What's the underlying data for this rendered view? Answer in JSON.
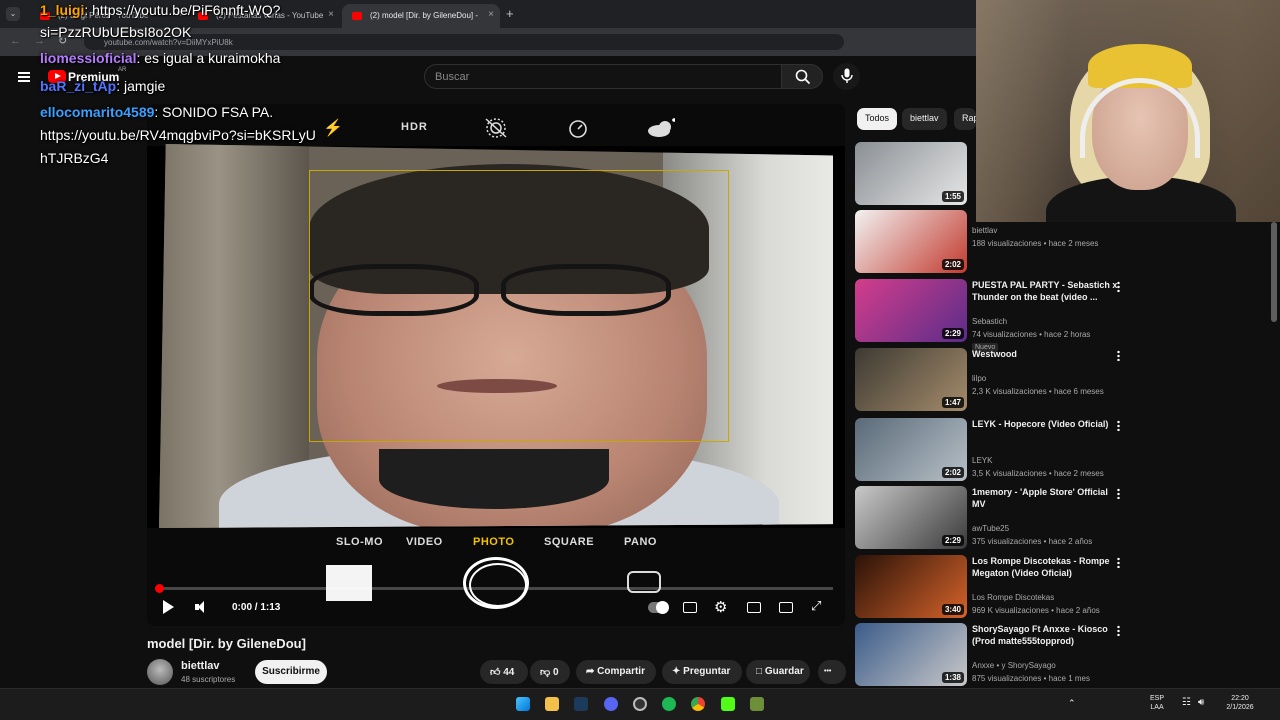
{
  "browser": {
    "tabs": [
      {
        "label": "(2) Luigi Pérez - YouTube",
        "active": false
      },
      {
        "label": "(2) Pestañas varias - YouTube",
        "active": false
      },
      {
        "label": "(2) model [Dir. by GileneDou] -",
        "active": true
      }
    ],
    "new_tab": "+",
    "url": "youtube.com/watch?v=DiiMYxPiU8k"
  },
  "youtube": {
    "logo_text": "Premium",
    "logo_region": "AR",
    "search_placeholder": "Buscar"
  },
  "camera_ui": {
    "top_labels": [
      "HDR"
    ],
    "modes": [
      "SLO-MO",
      "VIDEO",
      "PHOTO",
      "SQUARE",
      "PANO"
    ],
    "selected_mode": "PHOTO"
  },
  "player": {
    "time": "0:00 / 1:13",
    "progress_fraction": 0.0
  },
  "video": {
    "title": "model [Dir. by GileneDou]",
    "channel": "biettlav",
    "subscribers": "48 suscriptores",
    "subscribe_label": "Suscribirme",
    "likes": "44",
    "dislikes": "0",
    "share_label": "Compartir",
    "ask_label": "Preguntar",
    "save_label": "Guardar",
    "more_label": "•••"
  },
  "chips": [
    "Todos",
    "biettlav",
    "Rap"
  ],
  "recommendations": [
    {
      "title": "",
      "channel": "",
      "views": "",
      "duration": "1:55",
      "colors": [
        "#8a8f94",
        "#e7e7e7"
      ]
    },
    {
      "title": "",
      "channel": "biettlav",
      "views": "188 visualizaciones • hace 2 meses",
      "duration": "2:02",
      "colors": [
        "#f2f2f2",
        "#c23a2e"
      ]
    },
    {
      "title": "PUESTA PAL PARTY - Sebastich x Thunder on the beat (video ...",
      "channel": "Sebastich",
      "views": "74 visualizaciones • hace 2 horas",
      "badge": "Nuevo",
      "duration": "2:29",
      "colors": [
        "#d43d8b",
        "#5a2d8a"
      ]
    },
    {
      "title": "Westwood",
      "channel": "lilpo",
      "views": "2,3 K visualizaciones • hace 6 meses",
      "duration": "1:47",
      "colors": [
        "#3d3a33",
        "#a58c6b"
      ]
    },
    {
      "title": "LEYK - Hopecore (Video Oficial)",
      "channel": "LEYK",
      "views": "3,5 K visualizaciones • hace 2 meses",
      "duration": "2:02",
      "colors": [
        "#5a6a78",
        "#b7c0c8"
      ]
    },
    {
      "title": "1memory - 'Apple Store' Official MV",
      "channel": "awTube25",
      "views": "375 visualizaciones • hace 2 años",
      "duration": "2:29",
      "colors": [
        "#c9c9c9",
        "#3a3a3a"
      ]
    },
    {
      "title": "Los Rompe Discotekas - Rompe Megaton (Video Oficial)",
      "channel": "Los Rompe Discotekas",
      "views": "969 K visualizaciones • hace 2 años",
      "duration": "3:40",
      "colors": [
        "#2a1208",
        "#d5632a"
      ]
    },
    {
      "title": "ShorySayago Ft Anxxe - Kiosco (Prod matte555topprod)",
      "channel": "Anxxe • y ShorySayago",
      "views": "875 visualizaciones • hace 1 mes",
      "duration": "1:38",
      "colors": [
        "#3b5b8a",
        "#c9c9c9"
      ]
    }
  ],
  "chat": [
    {
      "user": "1_luigi",
      "user_color": "#ffa500",
      "text": ": https://youtu.be/PiF6nnft-WQ?"
    },
    {
      "user": "",
      "user_color": "#ffffff",
      "text": "si=PzzRUbUEbsI8o2OK"
    },
    {
      "user": "liomessioficial",
      "user_color": "#b47bff",
      "text": ": es igual a kuraimokha"
    },
    {
      "user": "baR_zi_tAp",
      "user_color": "#4f74ff",
      "text": ": jamgie"
    },
    {
      "user": "ellocomarito4589",
      "user_color": "#3aa0ff",
      "text": ": SONIDO FSA PA."
    },
    {
      "user": "",
      "user_color": "#ffffff",
      "text": "https://youtu.be/RV4mqgbviPo?si=bKSRLyU"
    },
    {
      "user": "",
      "user_color": "#ffffff",
      "text": "hTJRBzG4"
    }
  ],
  "tray": {
    "lang": "ESP",
    "lang2": "LAA",
    "time": "22:20",
    "date": "2/1/2026"
  },
  "colors": {
    "accent": "#ff0000",
    "camera_yellow": "#f3c300"
  }
}
